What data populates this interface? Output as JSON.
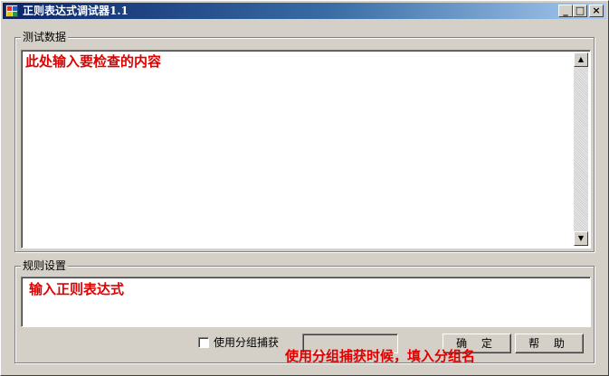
{
  "window": {
    "title": "正则表达式调试器1.1",
    "controls": {
      "minimize": "_",
      "maximize": "□",
      "close": "×"
    }
  },
  "test_data": {
    "group_label": "测试数据",
    "content": "此处输入要检查的内容"
  },
  "rules": {
    "group_label": "规则设置",
    "regex_value": "输入正则表达式",
    "use_group_capture_label": "使用分组捕获",
    "use_group_capture_checked": false,
    "group_name_value": "",
    "ok_button": "确 定",
    "help_button": "帮 助",
    "hint": "使用分组捕获时候，填入分组名"
  },
  "icons": {
    "app": "app-icon",
    "scroll_up": "arrow-up-icon",
    "scroll_down": "arrow-down-icon"
  },
  "colors": {
    "title_bar_start": "#0a246a",
    "title_bar_end": "#a6caf0",
    "annotation_red": "#e00000",
    "window_bg": "#d4d0c8"
  }
}
